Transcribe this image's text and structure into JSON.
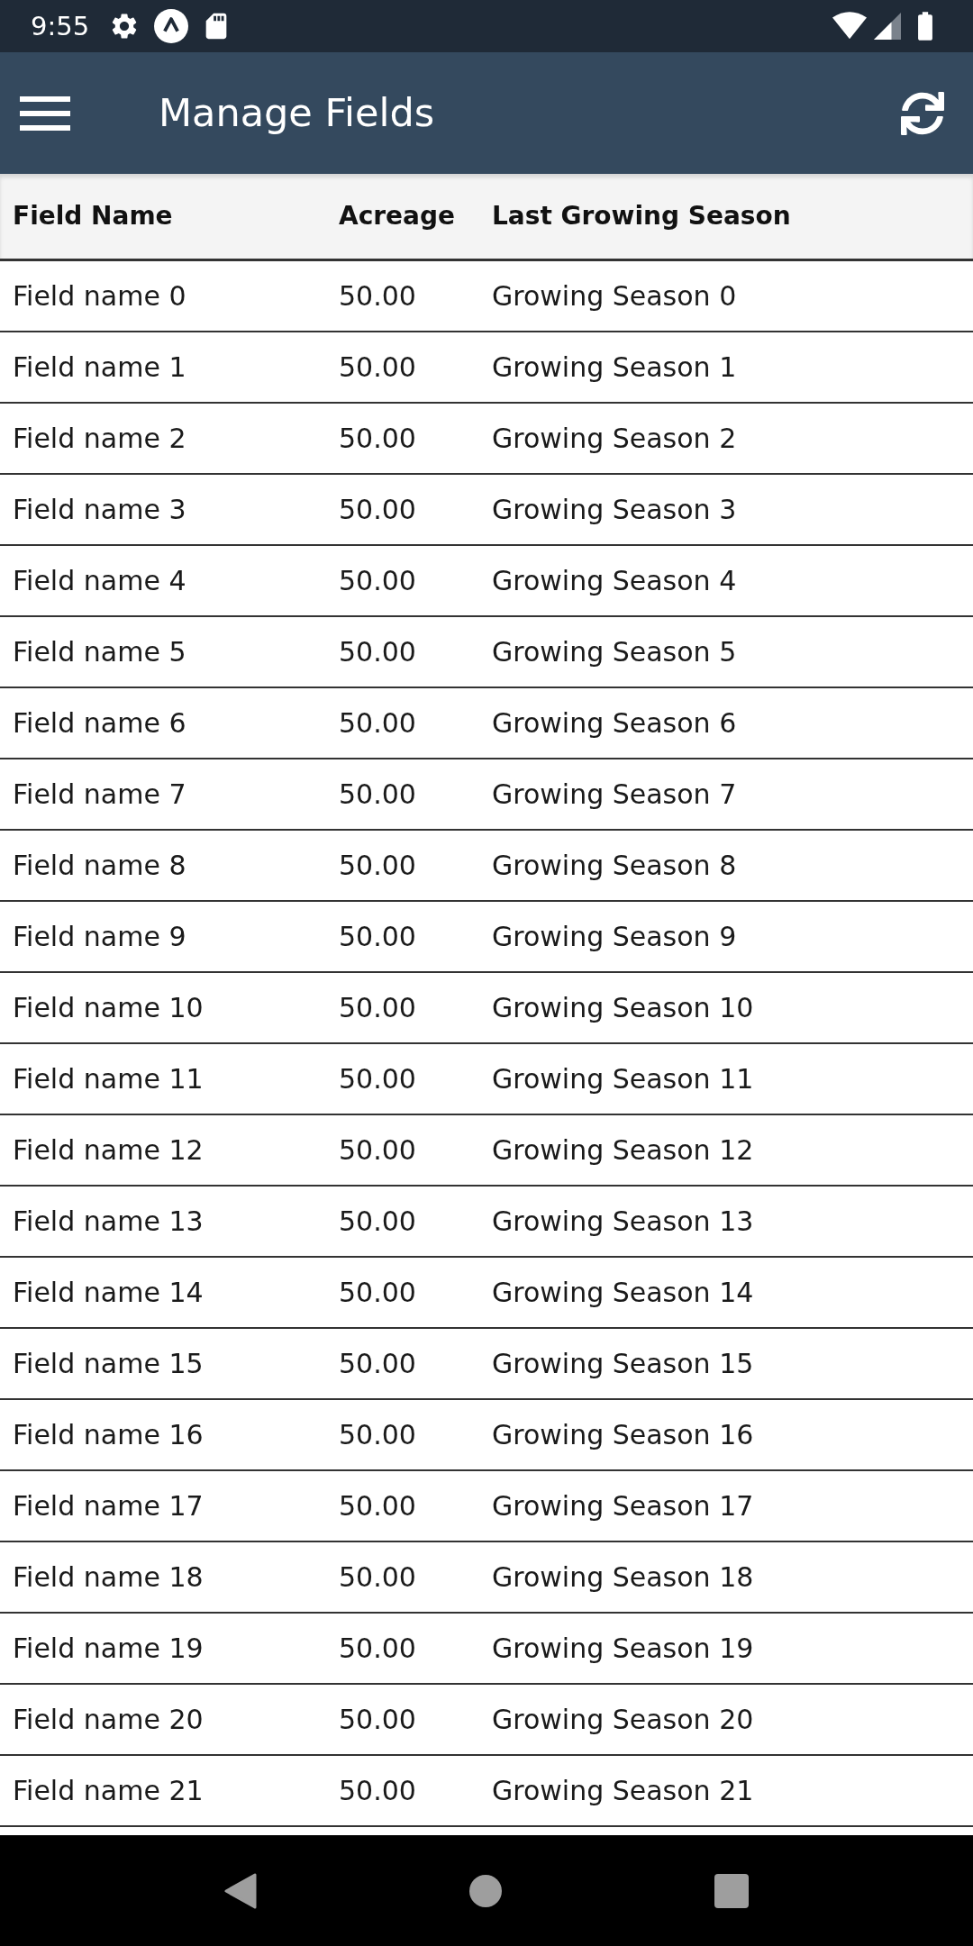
{
  "status_bar": {
    "time": "9:55"
  },
  "app_bar": {
    "title": "Manage Fields"
  },
  "table": {
    "columns": [
      "Field Name",
      "Acreage",
      "Last Growing Season"
    ],
    "rows": [
      [
        "Field name 0",
        "50.00",
        "Growing Season 0"
      ],
      [
        "Field name 1",
        "50.00",
        "Growing Season 1"
      ],
      [
        "Field name 2",
        "50.00",
        "Growing Season 2"
      ],
      [
        "Field name 3",
        "50.00",
        "Growing Season 3"
      ],
      [
        "Field name 4",
        "50.00",
        "Growing Season 4"
      ],
      [
        "Field name 5",
        "50.00",
        "Growing Season 5"
      ],
      [
        "Field name 6",
        "50.00",
        "Growing Season 6"
      ],
      [
        "Field name 7",
        "50.00",
        "Growing Season 7"
      ],
      [
        "Field name 8",
        "50.00",
        "Growing Season 8"
      ],
      [
        "Field name 9",
        "50.00",
        "Growing Season 9"
      ],
      [
        "Field name 10",
        "50.00",
        "Growing Season 10"
      ],
      [
        "Field name 11",
        "50.00",
        "Growing Season 11"
      ],
      [
        "Field name 12",
        "50.00",
        "Growing Season 12"
      ],
      [
        "Field name 13",
        "50.00",
        "Growing Season 13"
      ],
      [
        "Field name 14",
        "50.00",
        "Growing Season 14"
      ],
      [
        "Field name 15",
        "50.00",
        "Growing Season 15"
      ],
      [
        "Field name 16",
        "50.00",
        "Growing Season 16"
      ],
      [
        "Field name 17",
        "50.00",
        "Growing Season 17"
      ],
      [
        "Field name 18",
        "50.00",
        "Growing Season 18"
      ],
      [
        "Field name 19",
        "50.00",
        "Growing Season 19"
      ],
      [
        "Field name 20",
        "50.00",
        "Growing Season 20"
      ],
      [
        "Field name 21",
        "50.00",
        "Growing Season 21"
      ]
    ]
  }
}
